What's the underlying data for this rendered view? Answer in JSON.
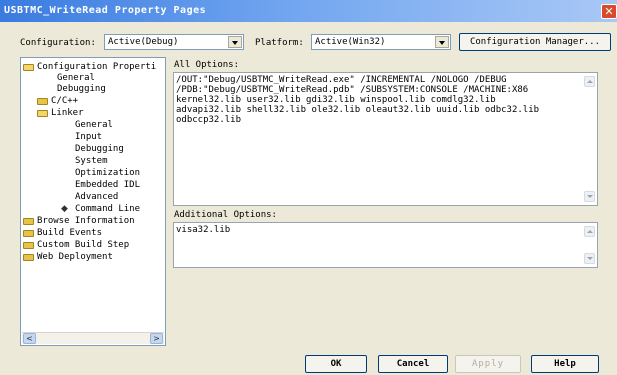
{
  "window": {
    "title": "USBTMC_WriteRead Property Pages",
    "close_label": "✕"
  },
  "config_row": {
    "configuration_label": "Configuration:",
    "configuration_value": "Active(Debug)",
    "platform_label": "Platform:",
    "platform_value": "Active(Win32)",
    "config_manager_label": "Configuration Manager..."
  },
  "tree": {
    "items": [
      {
        "label": "Configuration Properti",
        "icon": "folder-open-icon"
      },
      {
        "label": "General",
        "icon": ""
      },
      {
        "label": "Debugging",
        "icon": ""
      },
      {
        "label": "C/C++",
        "icon": "folder-icon"
      },
      {
        "label": "Linker",
        "icon": "folder-open-icon"
      },
      {
        "label": "General",
        "icon": ""
      },
      {
        "label": "Input",
        "icon": ""
      },
      {
        "label": "Debugging",
        "icon": ""
      },
      {
        "label": "System",
        "icon": ""
      },
      {
        "label": "Optimization",
        "icon": ""
      },
      {
        "label": "Embedded IDL",
        "icon": ""
      },
      {
        "label": "Advanced",
        "icon": ""
      },
      {
        "label": "Command Line",
        "icon": "diamond-icon"
      },
      {
        "label": "Browse Information",
        "icon": "folder-icon"
      },
      {
        "label": "Build Events",
        "icon": "folder-icon"
      },
      {
        "label": "Custom Build Step",
        "icon": "folder-icon"
      },
      {
        "label": "Web Deployment",
        "icon": "folder-icon"
      }
    ],
    "scroll_left": "<",
    "scroll_right": ">"
  },
  "all_options": {
    "label": "All Options:",
    "lines": [
      "/OUT:\"Debug/USBTMC_WriteRead.exe\" /INCREMENTAL /NOLOGO /DEBUG",
      "/PDB:\"Debug/USBTMC_WriteRead.pdb\" /SUBSYSTEM:CONSOLE /MACHINE:X86",
      "kernel32.lib user32.lib gdi32.lib winspool.lib comdlg32.lib",
      "advapi32.lib shell32.lib ole32.lib oleaut32.lib uuid.lib odbc32.lib",
      "odbccp32.lib"
    ]
  },
  "additional_options": {
    "label": "Additional Options:",
    "value": "visa32.lib"
  },
  "buttons": {
    "ok": "OK",
    "cancel": "Cancel",
    "apply": "Apply",
    "help": "Help"
  }
}
